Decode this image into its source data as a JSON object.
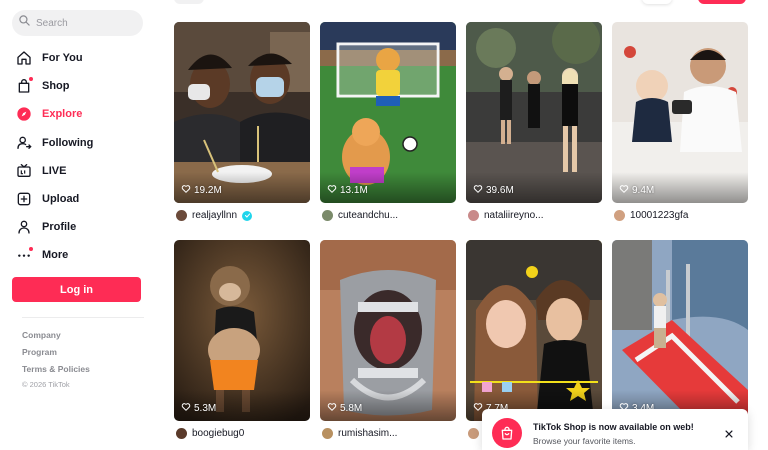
{
  "search": {
    "placeholder": "Search"
  },
  "nav": {
    "items": [
      {
        "label": "For You",
        "icon": "home-icon"
      },
      {
        "label": "Shop",
        "icon": "shopping-bag-icon"
      },
      {
        "label": "Explore",
        "icon": "compass-icon",
        "active": true
      },
      {
        "label": "Following",
        "icon": "user-following-icon"
      },
      {
        "label": "LIVE",
        "icon": "live-tv-icon"
      },
      {
        "label": "Upload",
        "icon": "plus-square-icon"
      },
      {
        "label": "Profile",
        "icon": "person-icon"
      },
      {
        "label": "More",
        "icon": "more-dots-icon"
      }
    ]
  },
  "login": {
    "label": "Log in"
  },
  "footer": {
    "links": [
      "Company",
      "Program",
      "Terms & Policies"
    ],
    "copyright": "© 2026 TikTok"
  },
  "videos": [
    {
      "likes": "19.2M",
      "author": "realjayllnn",
      "verified": true
    },
    {
      "likes": "13.1M",
      "author": "cuteandchu..."
    },
    {
      "likes": "39.6M",
      "author": "nataliireyno..."
    },
    {
      "likes": "9.4M",
      "author": "10001223gfa"
    },
    {
      "likes": "5.3M",
      "author": "boogiebug0"
    },
    {
      "likes": "5.8M",
      "author": "rumishasim..."
    },
    {
      "likes": "7.7M",
      "author": ""
    },
    {
      "likes": "3.4M",
      "author": ""
    }
  ],
  "toast": {
    "title": "TikTok Shop is now available on web!",
    "subtitle": "Browse your favorite items."
  },
  "colors": {
    "accent": "#fe2c55",
    "verified": "#20d5ec",
    "text": "#161823"
  }
}
